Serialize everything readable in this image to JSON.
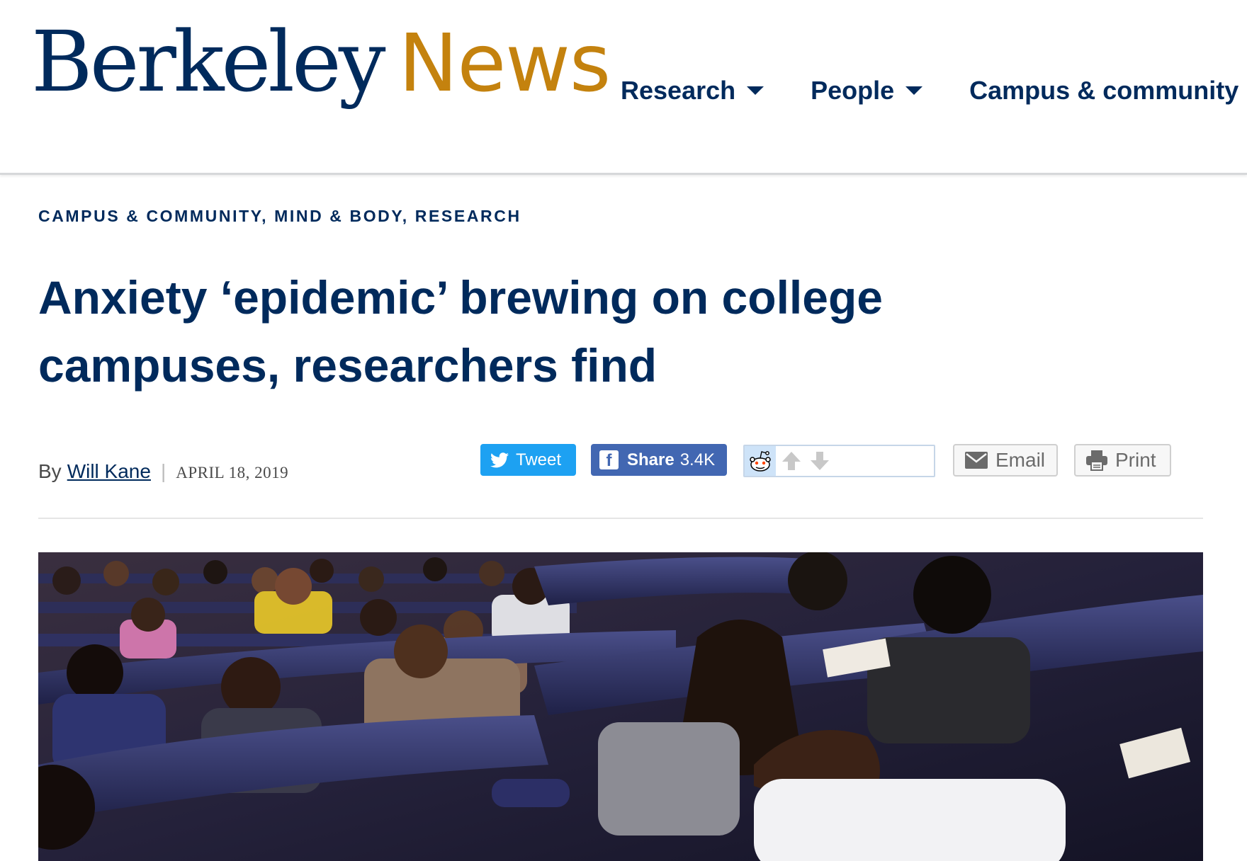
{
  "header": {
    "logo_primary": "Berkeley",
    "logo_secondary": "News",
    "nav": [
      {
        "label": "Research",
        "has_dropdown": true
      },
      {
        "label": "People",
        "has_dropdown": true
      },
      {
        "label": "Campus & community",
        "has_dropdown": false
      }
    ],
    "colors": {
      "navy": "#002a5c",
      "gold": "#c4820e"
    }
  },
  "article": {
    "categories": [
      "CAMPUS & COMMUNITY",
      "MIND & BODY",
      "RESEARCH"
    ],
    "category_separator": ", ",
    "headline": "Anxiety ‘epidemic’ brewing on college campuses, researchers find",
    "byline_prefix": "By",
    "author": "Will Kane",
    "byline_separator": "|",
    "date": "APRIL 18, 2019"
  },
  "share": {
    "tweet_label": "Tweet",
    "share_label": "Share",
    "share_count": "3.4K",
    "email_label": "Email",
    "print_label": "Print",
    "colors": {
      "twitter": "#1da1f2",
      "facebook": "#4267b2"
    }
  },
  "hero": {
    "image_subject": "students seated in lecture hall rows writing at desks",
    "icon": "photo"
  }
}
